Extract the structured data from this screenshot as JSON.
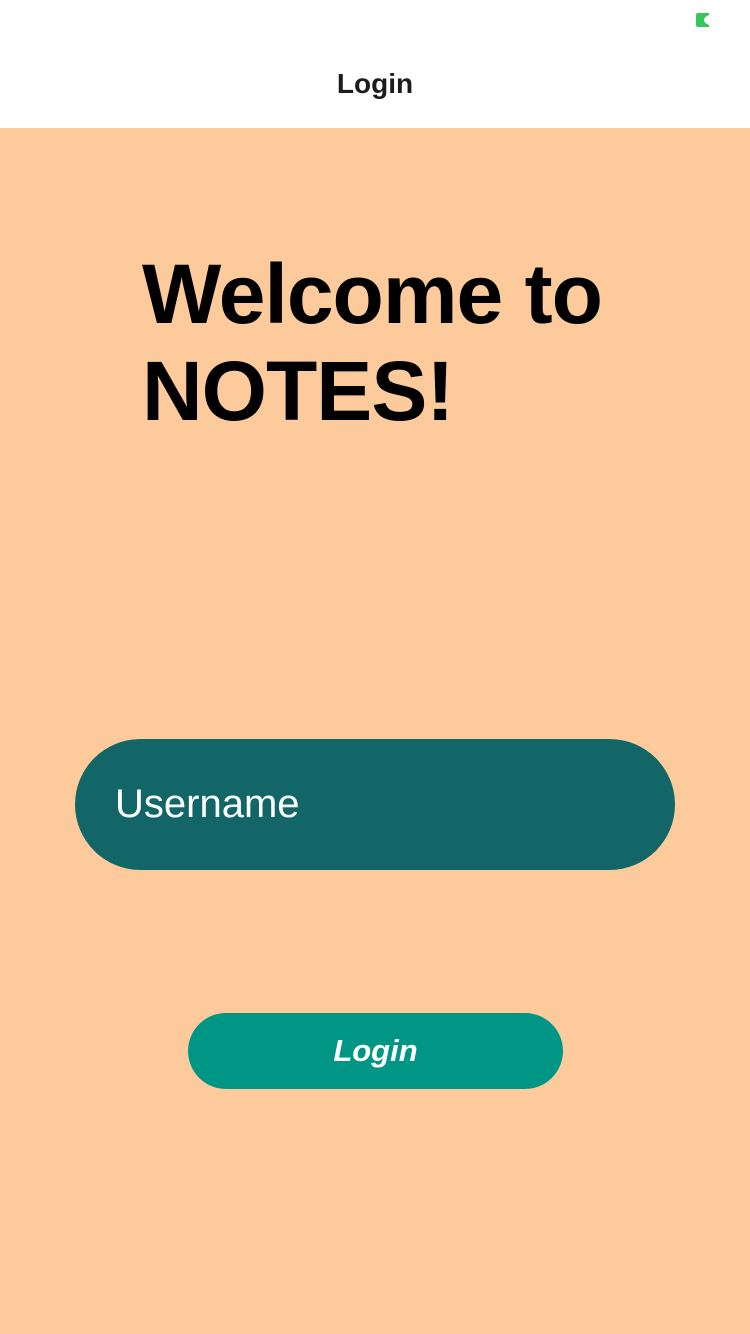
{
  "colors": {
    "background": "#fdcb9b",
    "header": "#ffffff",
    "input_fill": "#136668",
    "button_fill": "#009685",
    "battery_indicator": "#34c759"
  },
  "status_bar": {
    "icons": [
      "battery-icon"
    ]
  },
  "nav": {
    "title": "Login"
  },
  "main": {
    "welcome_line1": "Welcome to",
    "welcome_line2": "NOTES!",
    "username": {
      "value": "",
      "placeholder": "Username"
    },
    "login_button_label": "Login"
  }
}
